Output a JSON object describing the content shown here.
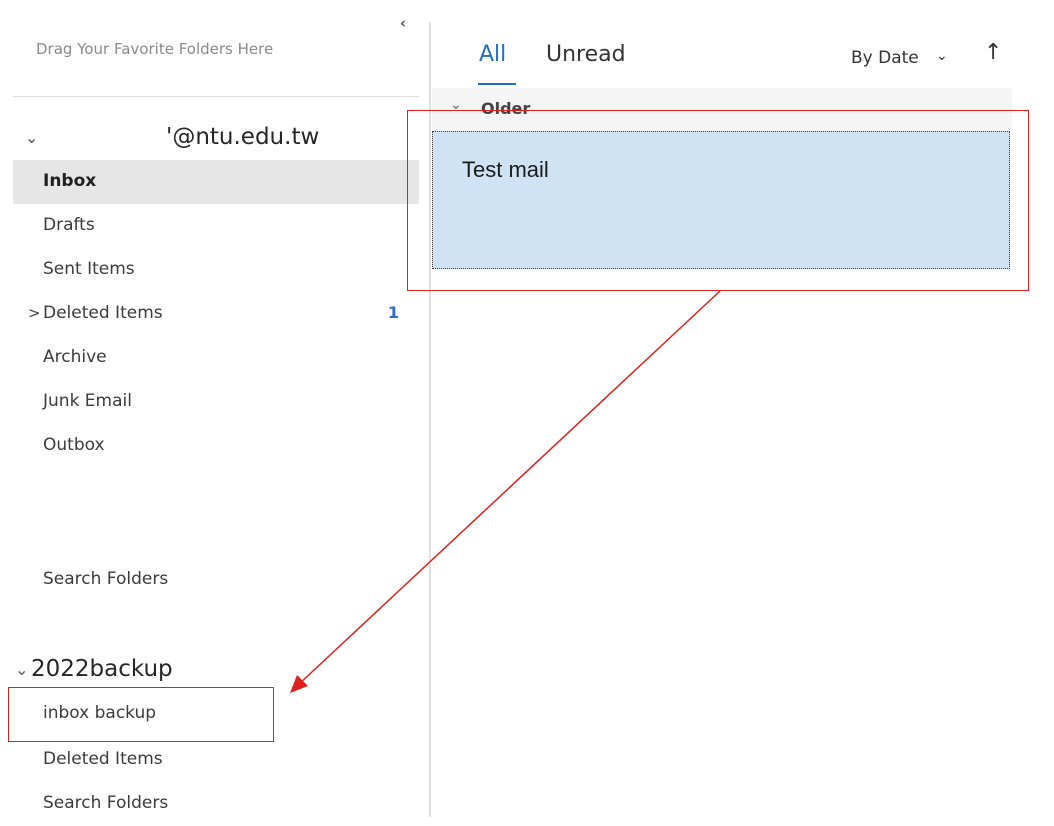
{
  "folder_pane": {
    "collapse_glyph": "‹",
    "favorites_hint": "Drag Your Favorite Folders Here",
    "account": {
      "name": "'@ntu.edu.tw",
      "folders": [
        {
          "label": "Inbox",
          "selected": true
        },
        {
          "label": "Drafts"
        },
        {
          "label": "Sent Items"
        },
        {
          "label": "Deleted Items",
          "count": "1",
          "expandable": true
        },
        {
          "label": "Archive"
        },
        {
          "label": "Junk Email"
        },
        {
          "label": "Outbox"
        },
        {
          "label": "Search Folders"
        }
      ]
    },
    "backup_store": {
      "name": "2022backup",
      "folders": [
        {
          "label": "inbox backup"
        },
        {
          "label": "Deleted Items"
        },
        {
          "label": "Search Folders"
        }
      ]
    }
  },
  "message_list": {
    "tabs": {
      "all": "All",
      "unread": "Unread"
    },
    "sort": {
      "label": "By Date",
      "chevron": "⌄",
      "direction": "↑"
    },
    "group": {
      "label": "Older",
      "chevron": "⌄"
    },
    "messages": [
      {
        "subject": "Test mail",
        "selected": true
      }
    ]
  },
  "colors": {
    "accent": "#1f6fc5",
    "selection": "#cfe3f5",
    "annotation": "#e0201e"
  }
}
